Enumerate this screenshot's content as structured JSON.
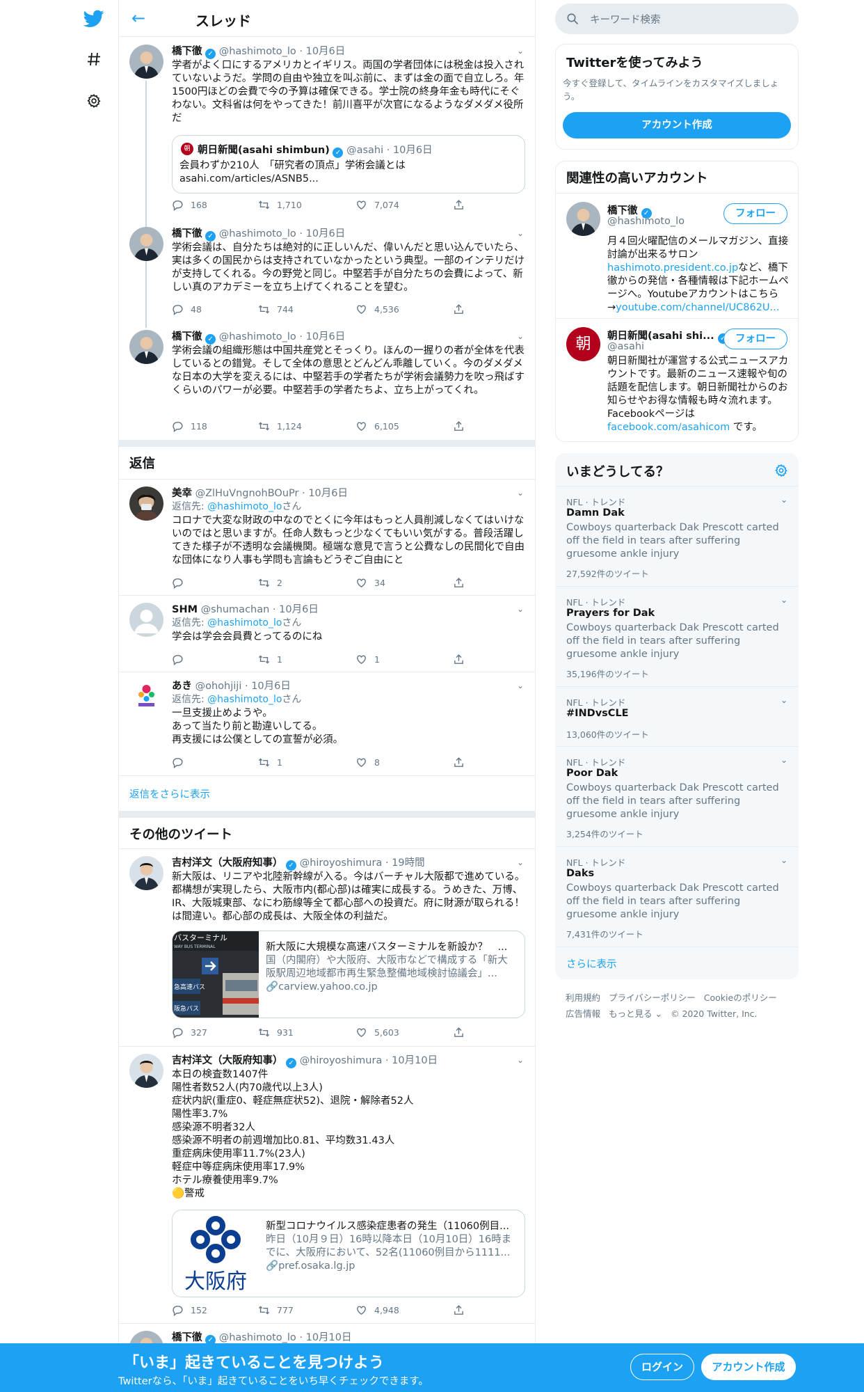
{
  "colors": {
    "accent": "#1da1f2",
    "text": "#14171a",
    "muted": "#657786",
    "border": "#e6ecf0"
  },
  "nav": {
    "icons": [
      "twitter-logo-icon",
      "hashtag-icon",
      "gear-icon"
    ]
  },
  "header": {
    "title": "スレッド"
  },
  "thread": [
    {
      "name": "橋下徹",
      "handle": "@hashimoto_lo",
      "time": "10月6日",
      "text": "学者がよく口にするアメリカとイギリス。両国の学者団体には税金は投入されていないようだ。学問の自由や独立を叫ぶ前に、まずは金の面で自立しろ。年1500円ほどの会費で今の予算は確保できる。学士院の終身年金も時代にそぐわない。文科省は何をやってきた！前川喜平が次官になるようなダメダメ役所だ",
      "quote": {
        "name": "朝日新聞(asahi shimbun)",
        "handle": "@asahi",
        "time": "10月6日",
        "text": "会員わずか210人　「研究者の頂点」学術会議とは",
        "link": "asahi.com/articles/ASNB5..."
      },
      "replies": "168",
      "retweets": "1,710",
      "likes": "7,074"
    },
    {
      "name": "橋下徹",
      "handle": "@hashimoto_lo",
      "time": "10月6日",
      "text": "学術会議は、自分たちは絶対的に正しいんだ、偉いんだと思い込んでいたら、実は多くの国民からは支持されていなかったという典型。一部のインテリだけが支持してくれる。今の野党と同じ。中堅若手が自分たちの会費によって、新しい真のアカデミーを立ち上げてくれることを望む。",
      "replies": "48",
      "retweets": "744",
      "likes": "4,536"
    },
    {
      "name": "橋下徹",
      "handle": "@hashimoto_lo",
      "time": "10月6日",
      "text": "学術会議の組織形態は中国共産党とそっくり。ほんの一握りの者が全体を代表しているとの錯覚。そして全体の意思とどんどん乖離していく。今のダメダメな日本の大学を変えるには、中堅若手の学者たちが学術会議勢力を吹っ飛ばすくらいのパワーが必要。中堅若手の学者たちよ、立ち上がってくれ。",
      "replies": "118",
      "retweets": "1,124",
      "likes": "6,105"
    }
  ],
  "replies_section": {
    "title": "返信",
    "reply_prefix": "返信先: ",
    "reply_suffix": "さん",
    "items": [
      {
        "name": "美幸",
        "handle": "@ZlHuVngnohBOuPr",
        "time": "10月6日",
        "reply_to": "@hashimoto_lo",
        "text": "コロナで大変な財政の中なのでとくに今年はもっと人員削減しなくてはいけないのではと思いますが。任命人数もっと少なくてもいい気がする。普段活躍してきた様子が不透明な会議機関。極端な意見で言うと公費なしの民間化で自由な団体になり人事も学問も言論もどうぞご自由にと",
        "replies": "",
        "retweets": "2",
        "likes": "34"
      },
      {
        "name": "SHM",
        "handle": "@shumachan",
        "time": "10月6日",
        "reply_to": "@hashimoto_lo",
        "text": "学会は学会会員費とってるのにね",
        "replies": "",
        "retweets": "1",
        "likes": "1"
      },
      {
        "name": "あき",
        "handle": "@ohohjiji",
        "time": "10月6日",
        "reply_to": "@hashimoto_lo",
        "text": "一旦支援止めようや。\nあって当たり前と勘違いしてる。\n再支援には公僕としての宣誓が必須。",
        "replies": "",
        "retweets": "1",
        "likes": "8"
      }
    ],
    "show_more": "返信をさらに表示"
  },
  "more_section": {
    "title": "その他のツイート",
    "items": [
      {
        "name": "吉村洋文（大阪府知事）",
        "handle": "@hiroyoshimura",
        "time": "19時間",
        "text": "新大阪は、リニアや北陸新幹線が入る。今はバーチャル大阪都で進めている。都構想が実現したら、大阪市内(都心部)は確実に成長する。うめきた、万博、IR、大阪城東部、なにわ筋線等全て都心部への投資だ。府に財源が取られる！は間違い。都心部の成長は、大阪全体の利益だ。",
        "card": {
          "title": "新大阪に大規模な高速バスターミナルを新設か？　...",
          "desc": "国（内閣府）や大阪府、大阪市などで構成する「新大阪駅周辺地域都市再生緊急整備地域検討協議会」...",
          "link": "carview.yahoo.co.jp",
          "img_texts": [
            "バスターミナル",
            "WAY BUS TERMINAL",
            "急高速バス",
            "阪急バス"
          ]
        },
        "replies": "327",
        "retweets": "931",
        "likes": "5,603"
      },
      {
        "name": "吉村洋文（大阪府知事）",
        "handle": "@hiroyoshimura",
        "time": "10月10日",
        "text": "本日の検査数1407件\n陽性者数52人(内70歳代以上3人)\n症状内訳(重症0、軽症無症状52)、退院・解除者52人\n陽性率3.7%\n感染源不明者32人\n感染源不明者の前週増加比0.81、平均数31.43人\n重症病床使用率11.7%(23人)\n軽症中等症病床使用率17.9%\nホテル療養使用率9.7%\n🟡警戒",
        "card": {
          "title": "新型コロナウイルス感染症患者の発生（11060例目...",
          "desc": "昨日（10月９日）16時以降本日（10月10日）16時までに、大阪府において、52名(11060例目から1111...",
          "link": "pref.osaka.lg.jp",
          "img_text": "大阪府"
        },
        "replies": "152",
        "retweets": "777",
        "likes": "4,948"
      },
      {
        "name": "橋下徹",
        "handle": "@hashimoto_lo",
        "time": "10月10日"
      }
    ]
  },
  "right": {
    "search_placeholder": "キーワード検索",
    "signup_panel": {
      "title": "Twitterを使ってみよう",
      "desc": "今すぐ登録して、タイムラインをカスタマイズしましょう。",
      "button": "アカウント作成"
    },
    "related": {
      "title": "関連性の高いアカウント",
      "follow_label": "フォロー",
      "accounts": [
        {
          "name": "橋下徹",
          "handle": "@hashimoto_lo",
          "bio_1": "月４回火曜配信のメールマガジン、直接討論が出来るサロン",
          "bio_link1": "hashimoto.president.co.jp",
          "bio_2": "など、橋下徹からの発信・各種情報は下記ホームページへ。Youtubeアカウントはこちら→",
          "bio_link2": "youtube.com/channel/UC862U..."
        },
        {
          "name": "朝日新聞(asahi shi...",
          "handle": "@asahi",
          "avatar_char": "朝",
          "bio_1": "朝日新聞社が運営する公式ニュースアカウントです。最新のニュース速報や旬の話題を配信します。朝日新聞社からのお知らせやお得な情報も時々流れます。Facebookページは",
          "bio_link1": "facebook.com/asahicom",
          "bio_2": " です。"
        }
      ]
    },
    "trends": {
      "title": "いまどうしてる？",
      "items": [
        {
          "meta": "NFL · トレンド",
          "name": "Damn Dak",
          "desc": "Cowboys quarterback Dak Prescott carted off the field in tears after suffering gruesome ankle injury",
          "count": "27,592件のツイート"
        },
        {
          "meta": "NFL · トレンド",
          "name": "Prayers for Dak",
          "desc": "Cowboys quarterback Dak Prescott carted off the field in tears after suffering gruesome ankle injury",
          "count": "35,196件のツイート"
        },
        {
          "meta": "NFL · トレンド",
          "name": "#INDvsCLE",
          "desc": "",
          "count": "13,060件のツイート"
        },
        {
          "meta": "NFL · トレンド",
          "name": "Poor Dak",
          "desc": "Cowboys quarterback Dak Prescott carted off the field in tears after suffering gruesome ankle injury",
          "count": "3,254件のツイート"
        },
        {
          "meta": "NFL · トレンド",
          "name": "Daks",
          "desc": "Cowboys quarterback Dak Prescott carted off the field in tears after suffering gruesome ankle injury",
          "count": "7,431件のツイート"
        }
      ],
      "show_more": "さらに表示"
    },
    "footer": {
      "links": [
        "利用規約",
        "プライバシーポリシー",
        "Cookieのポリシー",
        "広告情報",
        "もっと見る ⌄",
        "© 2020 Twitter, Inc."
      ]
    }
  },
  "bottom_bar": {
    "title": "「いま」起きていることを見つけよう",
    "subtitle": "Twitterなら、「いま」起きていることをいち早くチェックできます。",
    "login": "ログイン",
    "signup": "アカウント作成"
  }
}
